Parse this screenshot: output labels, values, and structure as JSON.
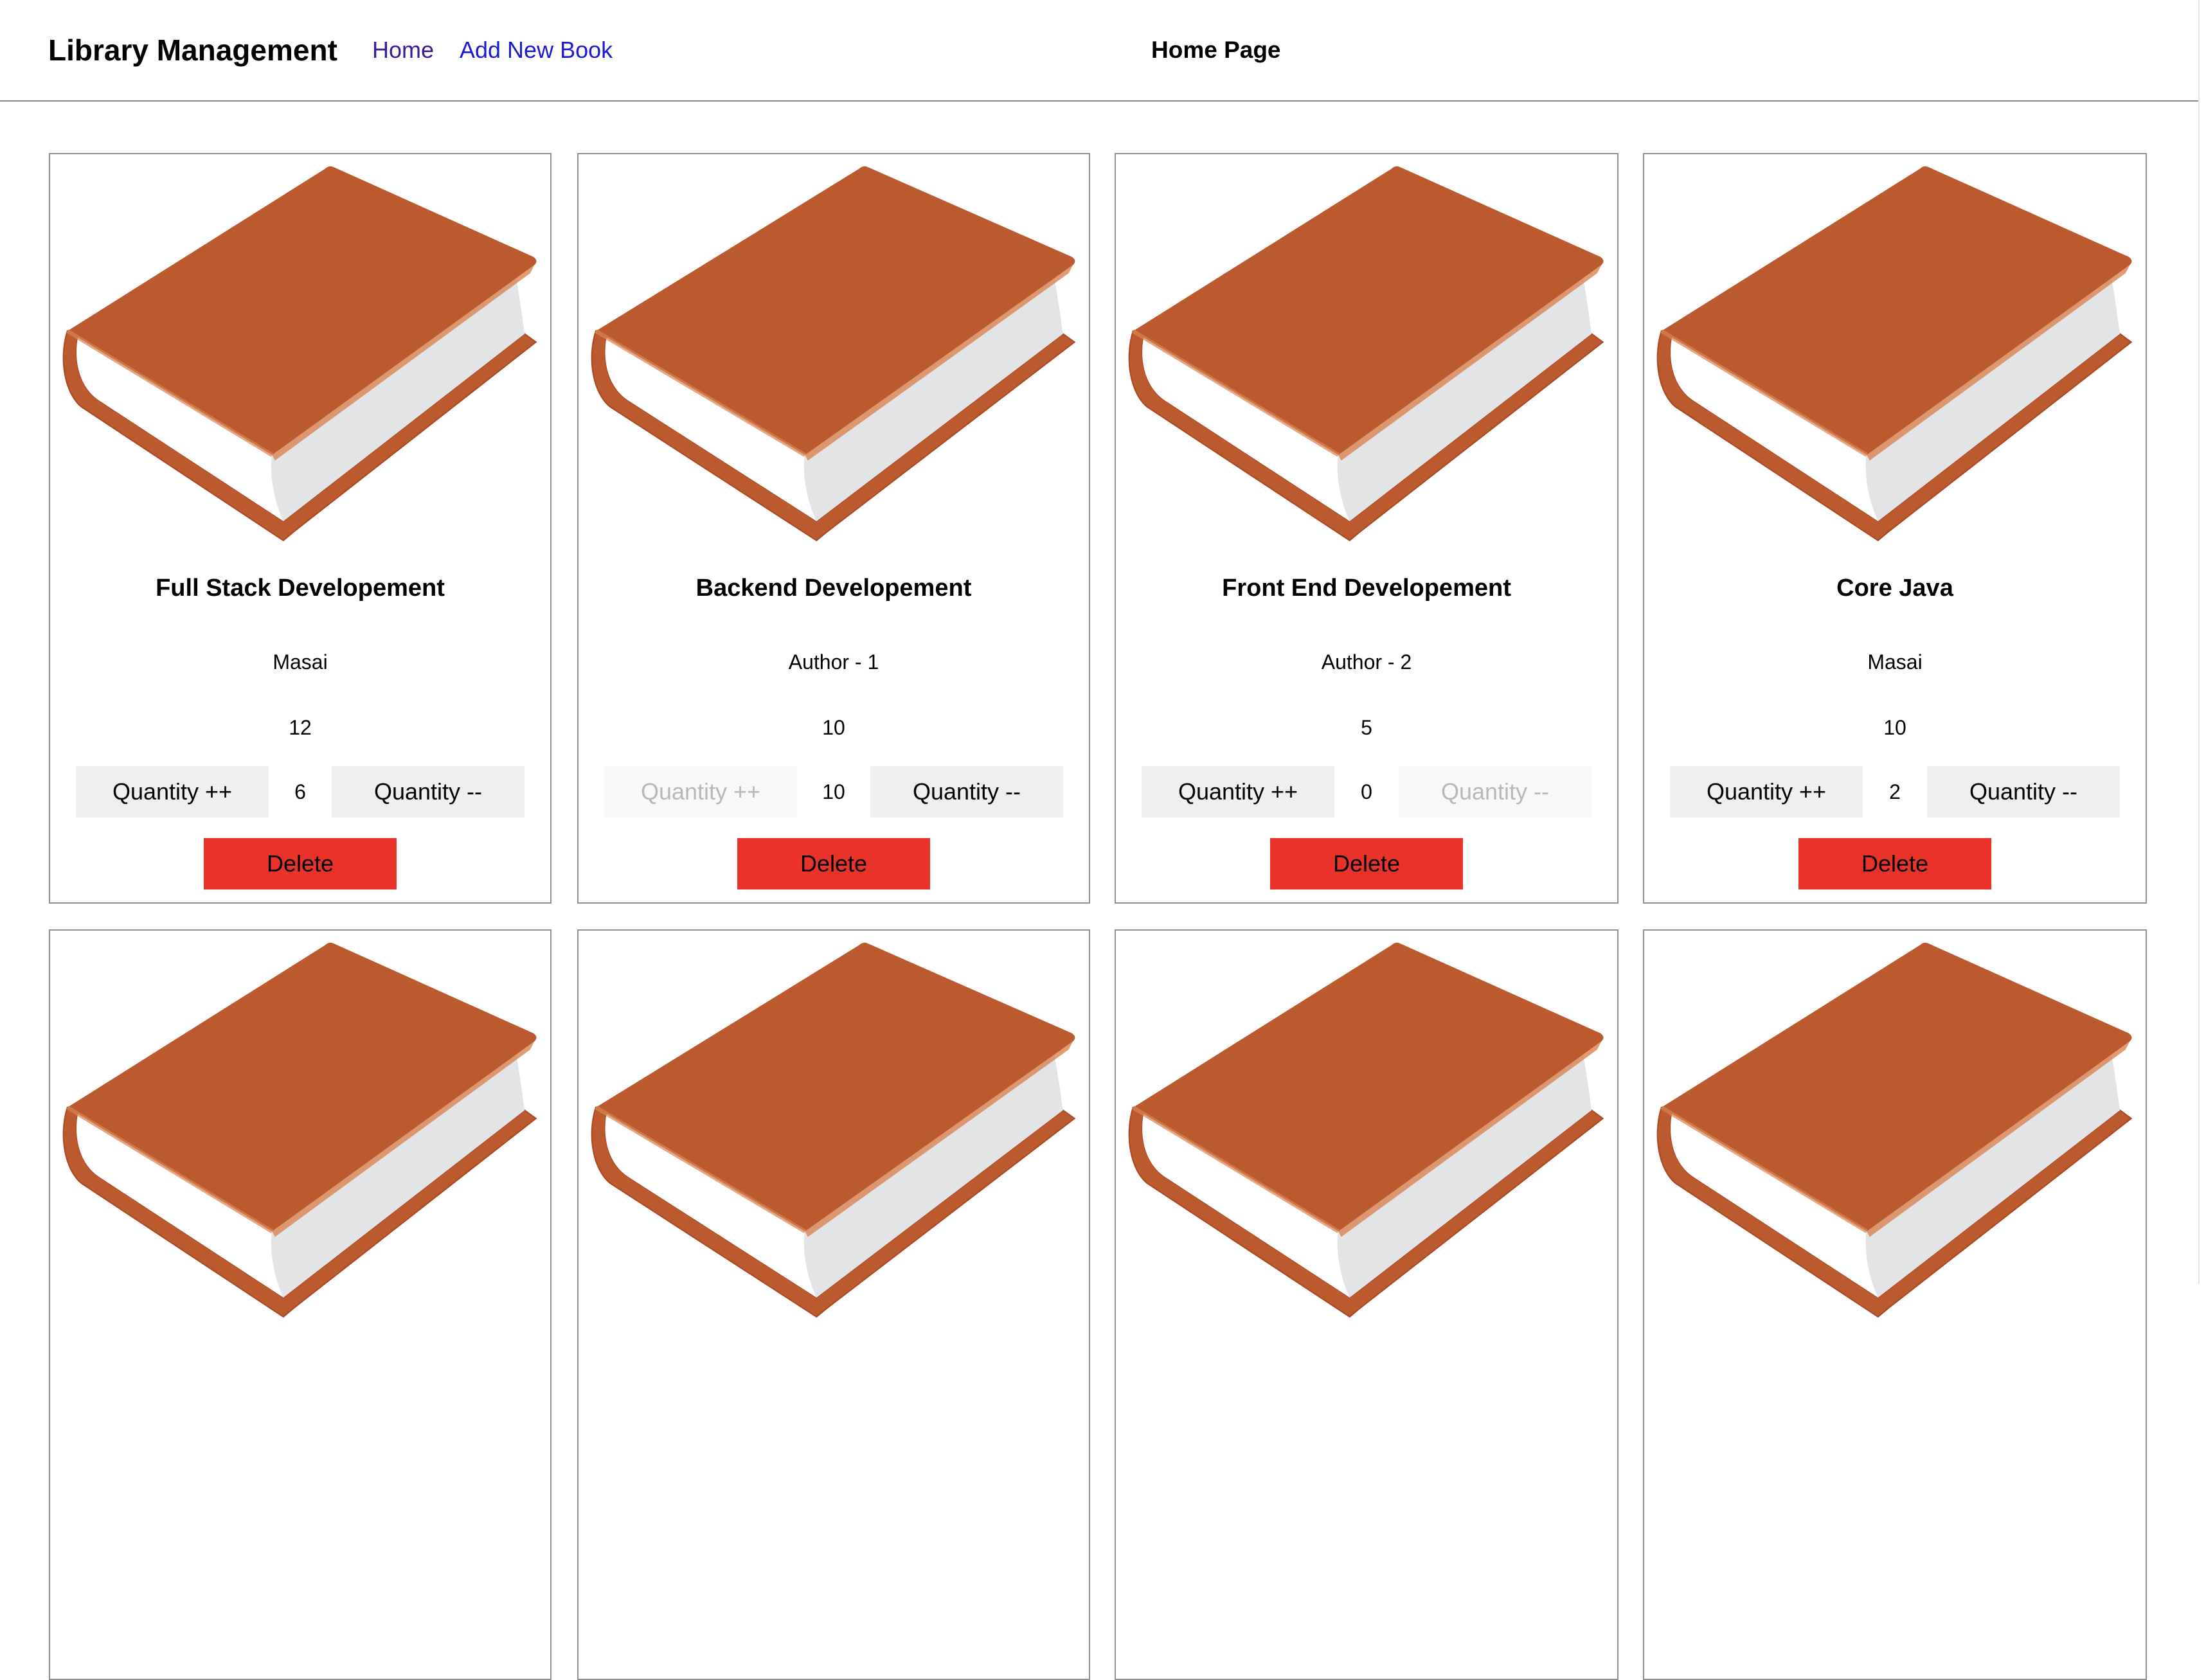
{
  "nav": {
    "brand": "Library Management",
    "home_label": "Home",
    "add_label": "Add New Book",
    "page_title": "Home Page"
  },
  "icons": {
    "book": "book-icon"
  },
  "colors": {
    "book_cover": "#bb5a2f",
    "delete_button": "#e8322a",
    "nav_home_link": "#3b1a96",
    "nav_add_link": "#1a1ad6"
  },
  "labels": {
    "increase": "Quantity ++",
    "decrease": "Quantity --",
    "delete": "Delete"
  },
  "books": [
    {
      "title": "Full Stack Developement",
      "author": "Masai",
      "price": "12",
      "quantity": "6",
      "increase_disabled": false,
      "decrease_disabled": false
    },
    {
      "title": "Backend Developement",
      "author": "Author - 1",
      "price": "10",
      "quantity": "10",
      "increase_disabled": true,
      "decrease_disabled": false
    },
    {
      "title": "Front End Developement",
      "author": "Author - 2",
      "price": "5",
      "quantity": "0",
      "increase_disabled": false,
      "decrease_disabled": true
    },
    {
      "title": "Core Java",
      "author": "Masai",
      "price": "10",
      "quantity": "2",
      "increase_disabled": false,
      "decrease_disabled": false
    },
    {
      "title": "",
      "author": "",
      "price": "",
      "quantity": "",
      "increase_disabled": false,
      "decrease_disabled": false
    },
    {
      "title": "",
      "author": "",
      "price": "",
      "quantity": "",
      "increase_disabled": false,
      "decrease_disabled": false
    },
    {
      "title": "",
      "author": "",
      "price": "",
      "quantity": "",
      "increase_disabled": false,
      "decrease_disabled": false
    },
    {
      "title": "",
      "author": "",
      "price": "",
      "quantity": "",
      "increase_disabled": false,
      "decrease_disabled": false
    }
  ]
}
